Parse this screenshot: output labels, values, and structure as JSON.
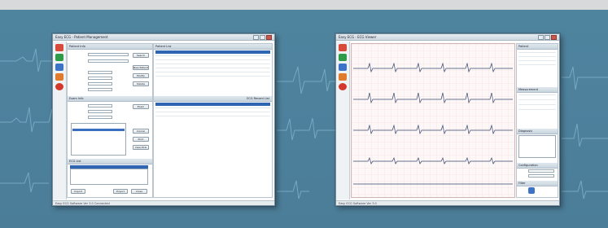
{
  "left_window": {
    "title": "Easy ECG - Patient Management",
    "left_panel": {
      "section1_title": "Patient Info",
      "section2_title": "Exam Info",
      "section3_title": "ECG List",
      "buttons": [
        "Search",
        "New Patient",
        "Modify",
        "Delete",
        "Exam",
        "Cancel",
        "Print",
        "View ECG"
      ],
      "footer_buttons": [
        "Import",
        "Export",
        "Close"
      ]
    },
    "right_panel": {
      "toolbar_text": "Patient List",
      "list_title": "ECG Record List"
    },
    "status": "Easy ECG Software Ver 3.0  Connected"
  },
  "right_window": {
    "title": "Easy ECG - ECG Viewer",
    "side_sections": [
      "Patient",
      "Measurement",
      "Diagnosis",
      "Configuration",
      "Filter"
    ],
    "status": "Easy ECG Software Ver 3.0"
  }
}
